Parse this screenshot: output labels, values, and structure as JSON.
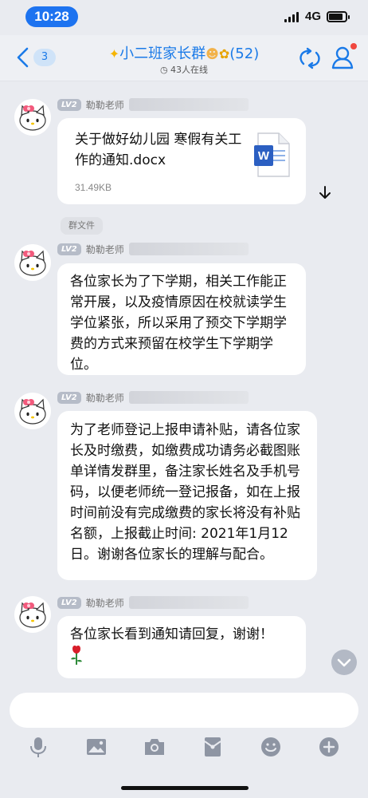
{
  "status_bar": {
    "time": "10:28",
    "network": "4G"
  },
  "nav": {
    "unread_count": "3",
    "title": "小二班家长群",
    "member_count": "(52)",
    "online": "43人在线",
    "accent": "#1a7ae8"
  },
  "messages": [
    {
      "level": "LV2",
      "sender": "勒勒老师",
      "type": "file",
      "file_name": "关于做好幼儿园 寒假有关工作的通知.docx",
      "file_size": "31.49KB",
      "file_icon": "word-doc-icon",
      "file_icon_letter": "W"
    },
    {
      "level": "LV2",
      "sender": "勒勒老师",
      "type": "text",
      "tag": "群文件",
      "text": "各位家长为了下学期，相关工作能正常开展，以及疫情原因在校就读学生学位紧张，所以采用了预交下学期学费的方式来预留在校学生下学期学位。"
    },
    {
      "level": "LV2",
      "sender": "勒勒老师",
      "type": "text",
      "text": "为了老师登记上报申请补贴，请各位家长及时缴费，如缴费成功请务必截图账单详情发群里，备注家长姓名及手机号码，以便老师统一登记报备，如在上报时间前没有完成缴费的家长将没有补贴名额，上报截止时间: 2021年1月12日。谢谢各位家长的理解与配合。"
    },
    {
      "level": "LV2",
      "sender": "勒勒老师",
      "type": "text",
      "text": "各位家长看到通知请回复，谢谢！",
      "emoji": "rose-icon"
    }
  ],
  "toolbar": [
    "mic-icon",
    "image-icon",
    "camera-icon",
    "red-packet-icon",
    "emoji-icon",
    "plus-icon"
  ]
}
